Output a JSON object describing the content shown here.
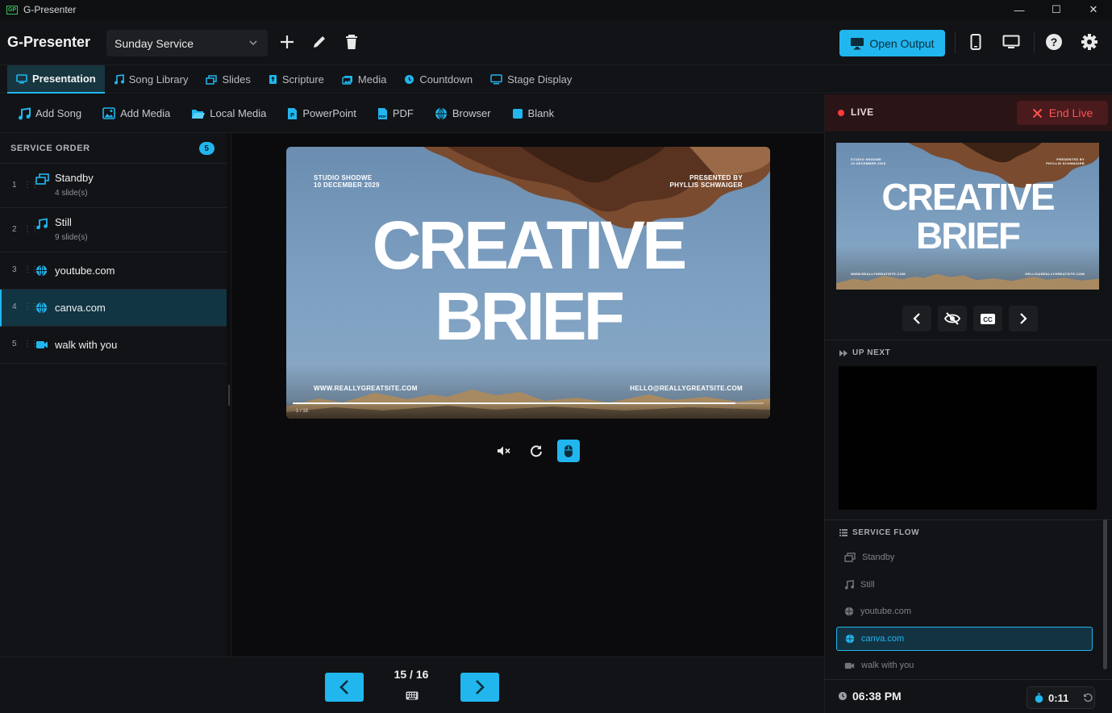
{
  "window": {
    "title": "G-Presenter",
    "app_badge": "GP",
    "min": "—",
    "max": "☐",
    "close": "✕"
  },
  "header": {
    "brand": "G-Presenter",
    "service": "Sunday Service",
    "open_output": "Open Output"
  },
  "tabs": [
    {
      "label": "Presentation",
      "icon": "monitor-icon",
      "active": true
    },
    {
      "label": "Song Library",
      "icon": "music-icon"
    },
    {
      "label": "Slides",
      "icon": "slides-icon"
    },
    {
      "label": "Scripture",
      "icon": "bible-icon"
    },
    {
      "label": "Media",
      "icon": "image-icon"
    },
    {
      "label": "Countdown",
      "icon": "clock-icon"
    },
    {
      "label": "Stage Display",
      "icon": "display-icon"
    }
  ],
  "toolbar": [
    {
      "label": "Add Song",
      "icon": "music-add-icon"
    },
    {
      "label": "Add Media",
      "icon": "image-add-icon"
    },
    {
      "label": "Local Media",
      "icon": "folder-icon"
    },
    {
      "label": "PowerPoint",
      "icon": "powerpoint-icon"
    },
    {
      "label": "PDF",
      "icon": "pdf-icon"
    },
    {
      "label": "Browser",
      "icon": "globe-icon"
    },
    {
      "label": "Blank",
      "icon": "blank-icon"
    }
  ],
  "service_order": {
    "title": "SERVICE ORDER",
    "count": "5",
    "items": [
      {
        "num": "1",
        "title": "Standby",
        "sub": "4 slide(s)",
        "icon": "slides-icon"
      },
      {
        "num": "2",
        "title": "Still",
        "sub": "9 slide(s)",
        "icon": "music-icon"
      },
      {
        "num": "3",
        "title": "youtube.com",
        "sub": "",
        "icon": "globe-icon"
      },
      {
        "num": "4",
        "title": "canva.com",
        "sub": "",
        "icon": "globe-icon",
        "active": true
      },
      {
        "num": "5",
        "title": "walk with you",
        "sub": "",
        "icon": "video-icon"
      }
    ]
  },
  "slide": {
    "top_left": "STUDIO SHODWE\n10 DECEMBER 2029",
    "top_right": "PRESENTED BY\nPHYLLIS SCHWAIGER",
    "line1": "CREATIVE",
    "line2": "BRIEF",
    "bottom_left": "WWW.REALLYGREATSITE.COM",
    "bottom_right": "HELLO@REALLYGREATSITE.COM",
    "player_page": "1 / 16",
    "player_progress": 0.94
  },
  "footer": {
    "page": "15 / 16"
  },
  "live": {
    "label": "LIVE",
    "end_live": "End Live",
    "up_next": "UP NEXT",
    "service_flow": "SERVICE FLOW",
    "flow": [
      {
        "label": "Standby",
        "icon": "slides-icon"
      },
      {
        "label": "Still",
        "icon": "music-icon"
      },
      {
        "label": "youtube.com",
        "icon": "globe-icon"
      },
      {
        "label": "canva.com",
        "icon": "globe-icon",
        "active": true
      },
      {
        "label": "walk with you",
        "icon": "video-icon"
      }
    ],
    "clock": "06:38 PM",
    "timer": "0:11"
  },
  "colors": {
    "accent": "#21b6ee",
    "live_red": "#ff3b3b",
    "end_live_text": "#ff5353"
  }
}
